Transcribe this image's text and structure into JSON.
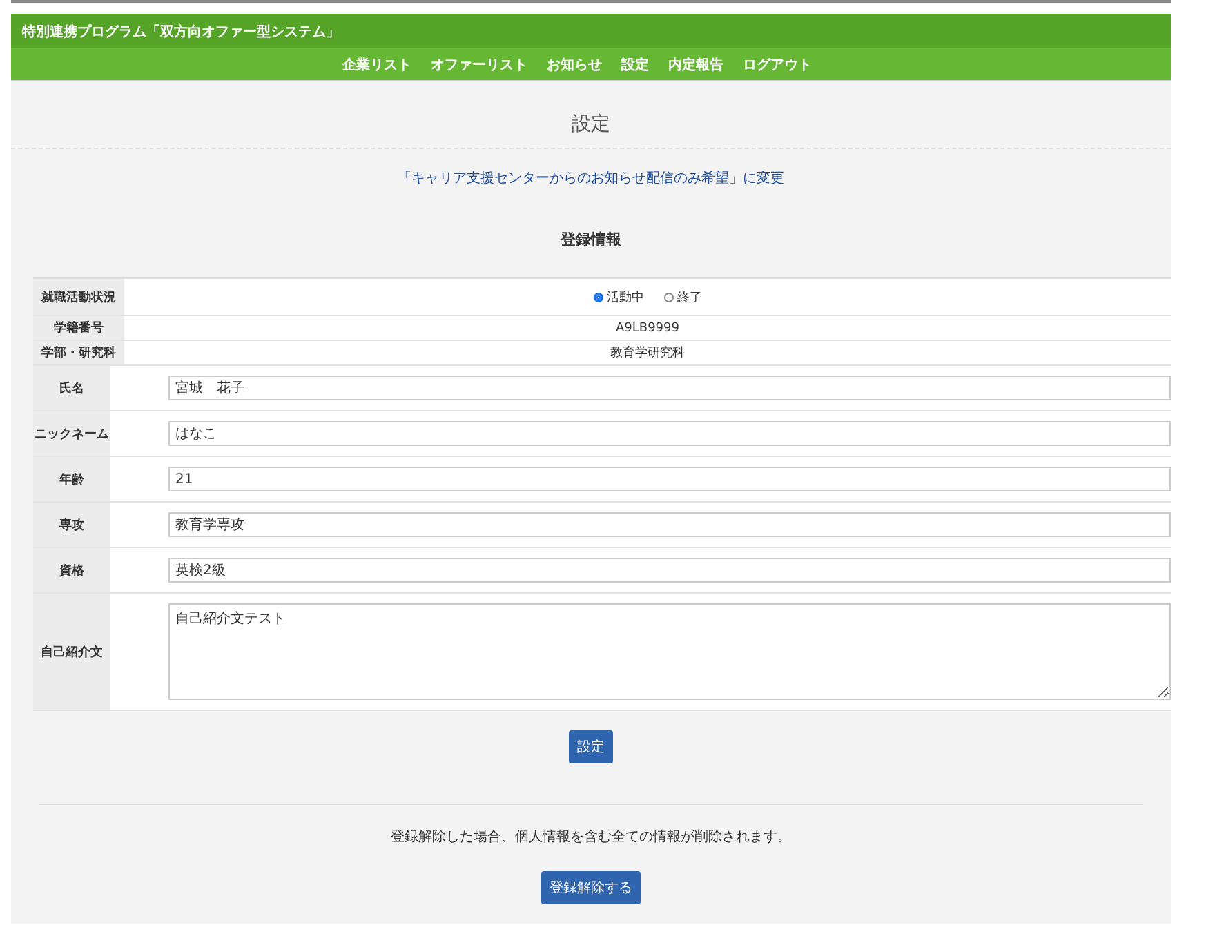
{
  "header": {
    "title": "特別連携プログラム「双方向オファー型システム」"
  },
  "nav": [
    {
      "label": "企業リスト"
    },
    {
      "label": "オファーリスト"
    },
    {
      "label": "お知らせ"
    },
    {
      "label": "設定"
    },
    {
      "label": "内定報告"
    },
    {
      "label": "ログアウト"
    }
  ],
  "page_title": "設定",
  "change_link": "「キャリア支援センターからのお知らせ配信のみ希望」に変更",
  "section_title": "登録情報",
  "rows": [
    {
      "kind": "radio",
      "label": "就職活動状況",
      "options": [
        {
          "label": "活動中",
          "selected": true
        },
        {
          "label": "終了",
          "selected": false
        }
      ]
    },
    {
      "kind": "text",
      "label": "学籍番号",
      "value": "A9LB9999"
    },
    {
      "kind": "text",
      "label": "学部・研究科",
      "value": "教育学研究科"
    },
    {
      "kind": "input",
      "label": "氏名",
      "value": "宮城　花子"
    },
    {
      "kind": "input",
      "label": "ニックネーム",
      "value": "はなこ"
    },
    {
      "kind": "input",
      "label": "年齢",
      "value": "21"
    },
    {
      "kind": "input",
      "label": "専攻",
      "value": "教育学専攻"
    },
    {
      "kind": "input",
      "label": "資格",
      "value": "英検2級"
    },
    {
      "kind": "textarea",
      "label": "自己紹介文",
      "value": "自己紹介文テスト"
    }
  ],
  "submit_button": "設定",
  "unregister_note": "登録解除した場合、個人情報を含む全ての情報が削除されます。",
  "unregister_button": "登録解除する"
}
